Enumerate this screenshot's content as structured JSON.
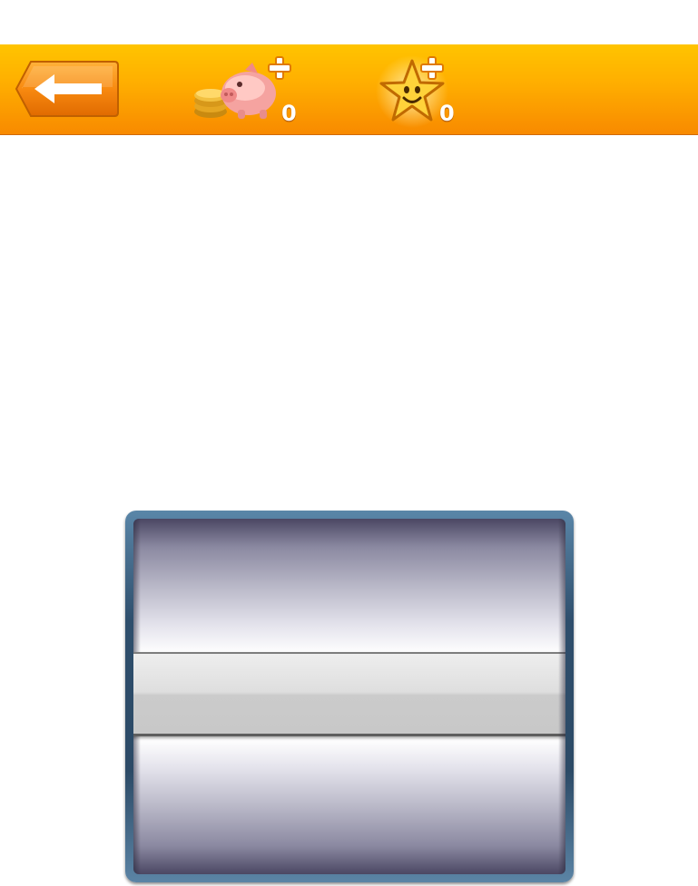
{
  "topbar": {
    "accent_color": "#ffb000",
    "back_button": {
      "icon": "left-arrow-icon"
    },
    "coins": {
      "icon": "piggy-bank-coins-plus-icon",
      "count": "0"
    },
    "stars": {
      "icon": "smiling-star-plus-icon",
      "count": "0"
    }
  },
  "picker": {
    "frame_color": "#2e4e6c",
    "selected_value": ""
  }
}
